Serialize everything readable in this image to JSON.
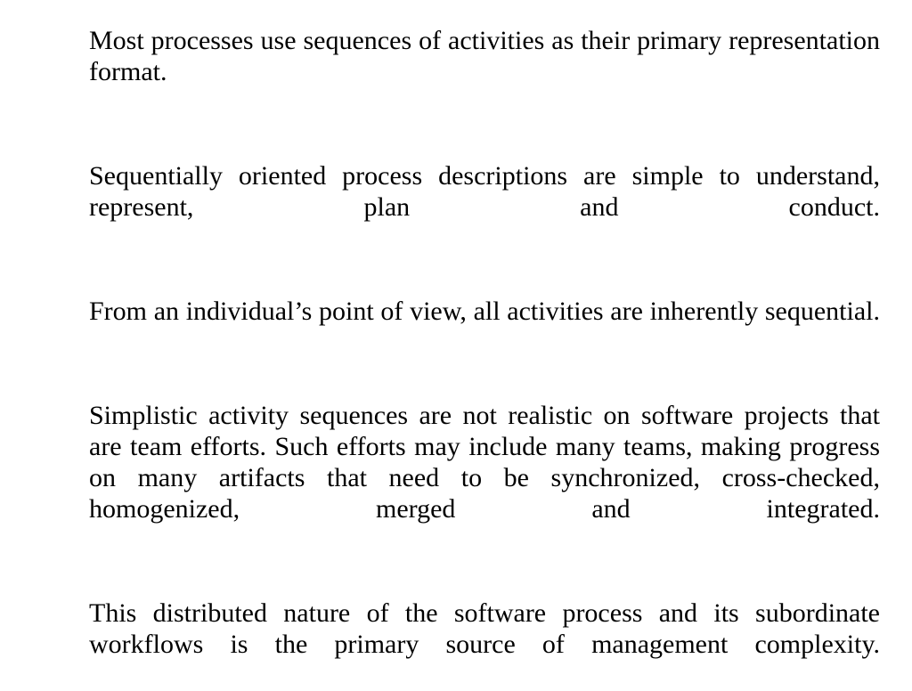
{
  "document": {
    "background_color": "#ffffff",
    "text_color": "#000000",
    "paragraphs": [
      {
        "id": "p1",
        "text": "Most processes use sequences of activities as their primary representation format."
      },
      {
        "id": "p2",
        "text": "Sequentially oriented process descriptions are simple to understand, represent, plan and conduct."
      },
      {
        "id": "p3",
        "text": "From an individual’s point of view, all activities are inherently sequential."
      },
      {
        "id": "p4",
        "text": "Simplistic activity sequences are not realistic on software projects that are team efforts. Such efforts may include many teams, making progress on many artifacts that need to be synchronized, cross-checked, homogenized, merged and integrated."
      },
      {
        "id": "p5",
        "text": "This distributed nature of the software process and its subordinate workflows is the primary source of management complexity."
      }
    ]
  }
}
